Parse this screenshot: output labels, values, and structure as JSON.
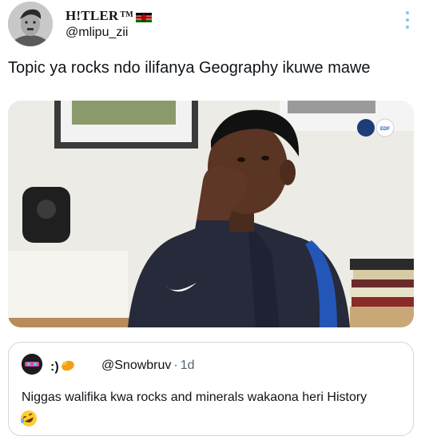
{
  "author": {
    "display_name": "H!TLER",
    "tm": "TM",
    "handle": "@mlipu_zii",
    "flag_icon": "kenya-flag-icon"
  },
  "tweet": {
    "text": "Topic ya rocks ndo ilifanya Geography ikuwe mawe"
  },
  "media": {
    "type": "video-still",
    "badge_text": "EDF"
  },
  "quoted_tweet": {
    "display_name": ":)",
    "handle": "@Snowbruv",
    "separator": "·",
    "time": "1d",
    "text": "Niggas walifika kwa rocks and minerals wakaona heri History",
    "trailing_emoji": "rolling-on-floor-laughing-emoji"
  },
  "colors": {
    "text": "#0f1419",
    "secondary": "#536471",
    "border": "#cfd9de",
    "more_dots": "#8ec3e8"
  }
}
